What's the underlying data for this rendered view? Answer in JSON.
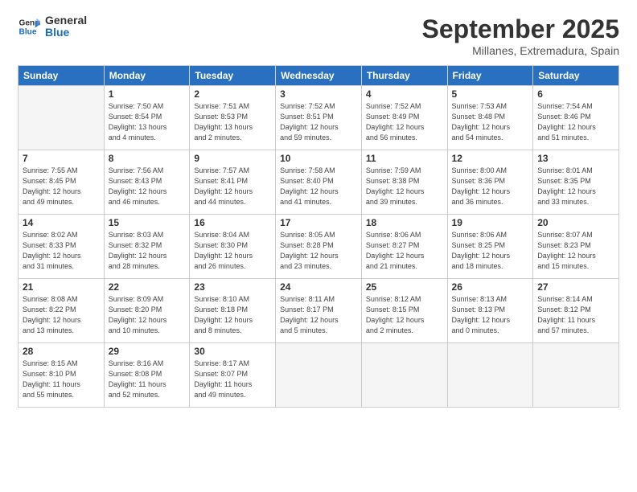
{
  "logo": {
    "line1": "General",
    "line2": "Blue"
  },
  "title": "September 2025",
  "subtitle": "Millanes, Extremadura, Spain",
  "days_of_week": [
    "Sunday",
    "Monday",
    "Tuesday",
    "Wednesday",
    "Thursday",
    "Friday",
    "Saturday"
  ],
  "weeks": [
    [
      {
        "num": "",
        "info": ""
      },
      {
        "num": "1",
        "info": "Sunrise: 7:50 AM\nSunset: 8:54 PM\nDaylight: 13 hours\nand 4 minutes."
      },
      {
        "num": "2",
        "info": "Sunrise: 7:51 AM\nSunset: 8:53 PM\nDaylight: 13 hours\nand 2 minutes."
      },
      {
        "num": "3",
        "info": "Sunrise: 7:52 AM\nSunset: 8:51 PM\nDaylight: 12 hours\nand 59 minutes."
      },
      {
        "num": "4",
        "info": "Sunrise: 7:52 AM\nSunset: 8:49 PM\nDaylight: 12 hours\nand 56 minutes."
      },
      {
        "num": "5",
        "info": "Sunrise: 7:53 AM\nSunset: 8:48 PM\nDaylight: 12 hours\nand 54 minutes."
      },
      {
        "num": "6",
        "info": "Sunrise: 7:54 AM\nSunset: 8:46 PM\nDaylight: 12 hours\nand 51 minutes."
      }
    ],
    [
      {
        "num": "7",
        "info": "Sunrise: 7:55 AM\nSunset: 8:45 PM\nDaylight: 12 hours\nand 49 minutes."
      },
      {
        "num": "8",
        "info": "Sunrise: 7:56 AM\nSunset: 8:43 PM\nDaylight: 12 hours\nand 46 minutes."
      },
      {
        "num": "9",
        "info": "Sunrise: 7:57 AM\nSunset: 8:41 PM\nDaylight: 12 hours\nand 44 minutes."
      },
      {
        "num": "10",
        "info": "Sunrise: 7:58 AM\nSunset: 8:40 PM\nDaylight: 12 hours\nand 41 minutes."
      },
      {
        "num": "11",
        "info": "Sunrise: 7:59 AM\nSunset: 8:38 PM\nDaylight: 12 hours\nand 39 minutes."
      },
      {
        "num": "12",
        "info": "Sunrise: 8:00 AM\nSunset: 8:36 PM\nDaylight: 12 hours\nand 36 minutes."
      },
      {
        "num": "13",
        "info": "Sunrise: 8:01 AM\nSunset: 8:35 PM\nDaylight: 12 hours\nand 33 minutes."
      }
    ],
    [
      {
        "num": "14",
        "info": "Sunrise: 8:02 AM\nSunset: 8:33 PM\nDaylight: 12 hours\nand 31 minutes."
      },
      {
        "num": "15",
        "info": "Sunrise: 8:03 AM\nSunset: 8:32 PM\nDaylight: 12 hours\nand 28 minutes."
      },
      {
        "num": "16",
        "info": "Sunrise: 8:04 AM\nSunset: 8:30 PM\nDaylight: 12 hours\nand 26 minutes."
      },
      {
        "num": "17",
        "info": "Sunrise: 8:05 AM\nSunset: 8:28 PM\nDaylight: 12 hours\nand 23 minutes."
      },
      {
        "num": "18",
        "info": "Sunrise: 8:06 AM\nSunset: 8:27 PM\nDaylight: 12 hours\nand 21 minutes."
      },
      {
        "num": "19",
        "info": "Sunrise: 8:06 AM\nSunset: 8:25 PM\nDaylight: 12 hours\nand 18 minutes."
      },
      {
        "num": "20",
        "info": "Sunrise: 8:07 AM\nSunset: 8:23 PM\nDaylight: 12 hours\nand 15 minutes."
      }
    ],
    [
      {
        "num": "21",
        "info": "Sunrise: 8:08 AM\nSunset: 8:22 PM\nDaylight: 12 hours\nand 13 minutes."
      },
      {
        "num": "22",
        "info": "Sunrise: 8:09 AM\nSunset: 8:20 PM\nDaylight: 12 hours\nand 10 minutes."
      },
      {
        "num": "23",
        "info": "Sunrise: 8:10 AM\nSunset: 8:18 PM\nDaylight: 12 hours\nand 8 minutes."
      },
      {
        "num": "24",
        "info": "Sunrise: 8:11 AM\nSunset: 8:17 PM\nDaylight: 12 hours\nand 5 minutes."
      },
      {
        "num": "25",
        "info": "Sunrise: 8:12 AM\nSunset: 8:15 PM\nDaylight: 12 hours\nand 2 minutes."
      },
      {
        "num": "26",
        "info": "Sunrise: 8:13 AM\nSunset: 8:13 PM\nDaylight: 12 hours\nand 0 minutes."
      },
      {
        "num": "27",
        "info": "Sunrise: 8:14 AM\nSunset: 8:12 PM\nDaylight: 11 hours\nand 57 minutes."
      }
    ],
    [
      {
        "num": "28",
        "info": "Sunrise: 8:15 AM\nSunset: 8:10 PM\nDaylight: 11 hours\nand 55 minutes."
      },
      {
        "num": "29",
        "info": "Sunrise: 8:16 AM\nSunset: 8:08 PM\nDaylight: 11 hours\nand 52 minutes."
      },
      {
        "num": "30",
        "info": "Sunrise: 8:17 AM\nSunset: 8:07 PM\nDaylight: 11 hours\nand 49 minutes."
      },
      {
        "num": "",
        "info": ""
      },
      {
        "num": "",
        "info": ""
      },
      {
        "num": "",
        "info": ""
      },
      {
        "num": "",
        "info": ""
      }
    ]
  ]
}
